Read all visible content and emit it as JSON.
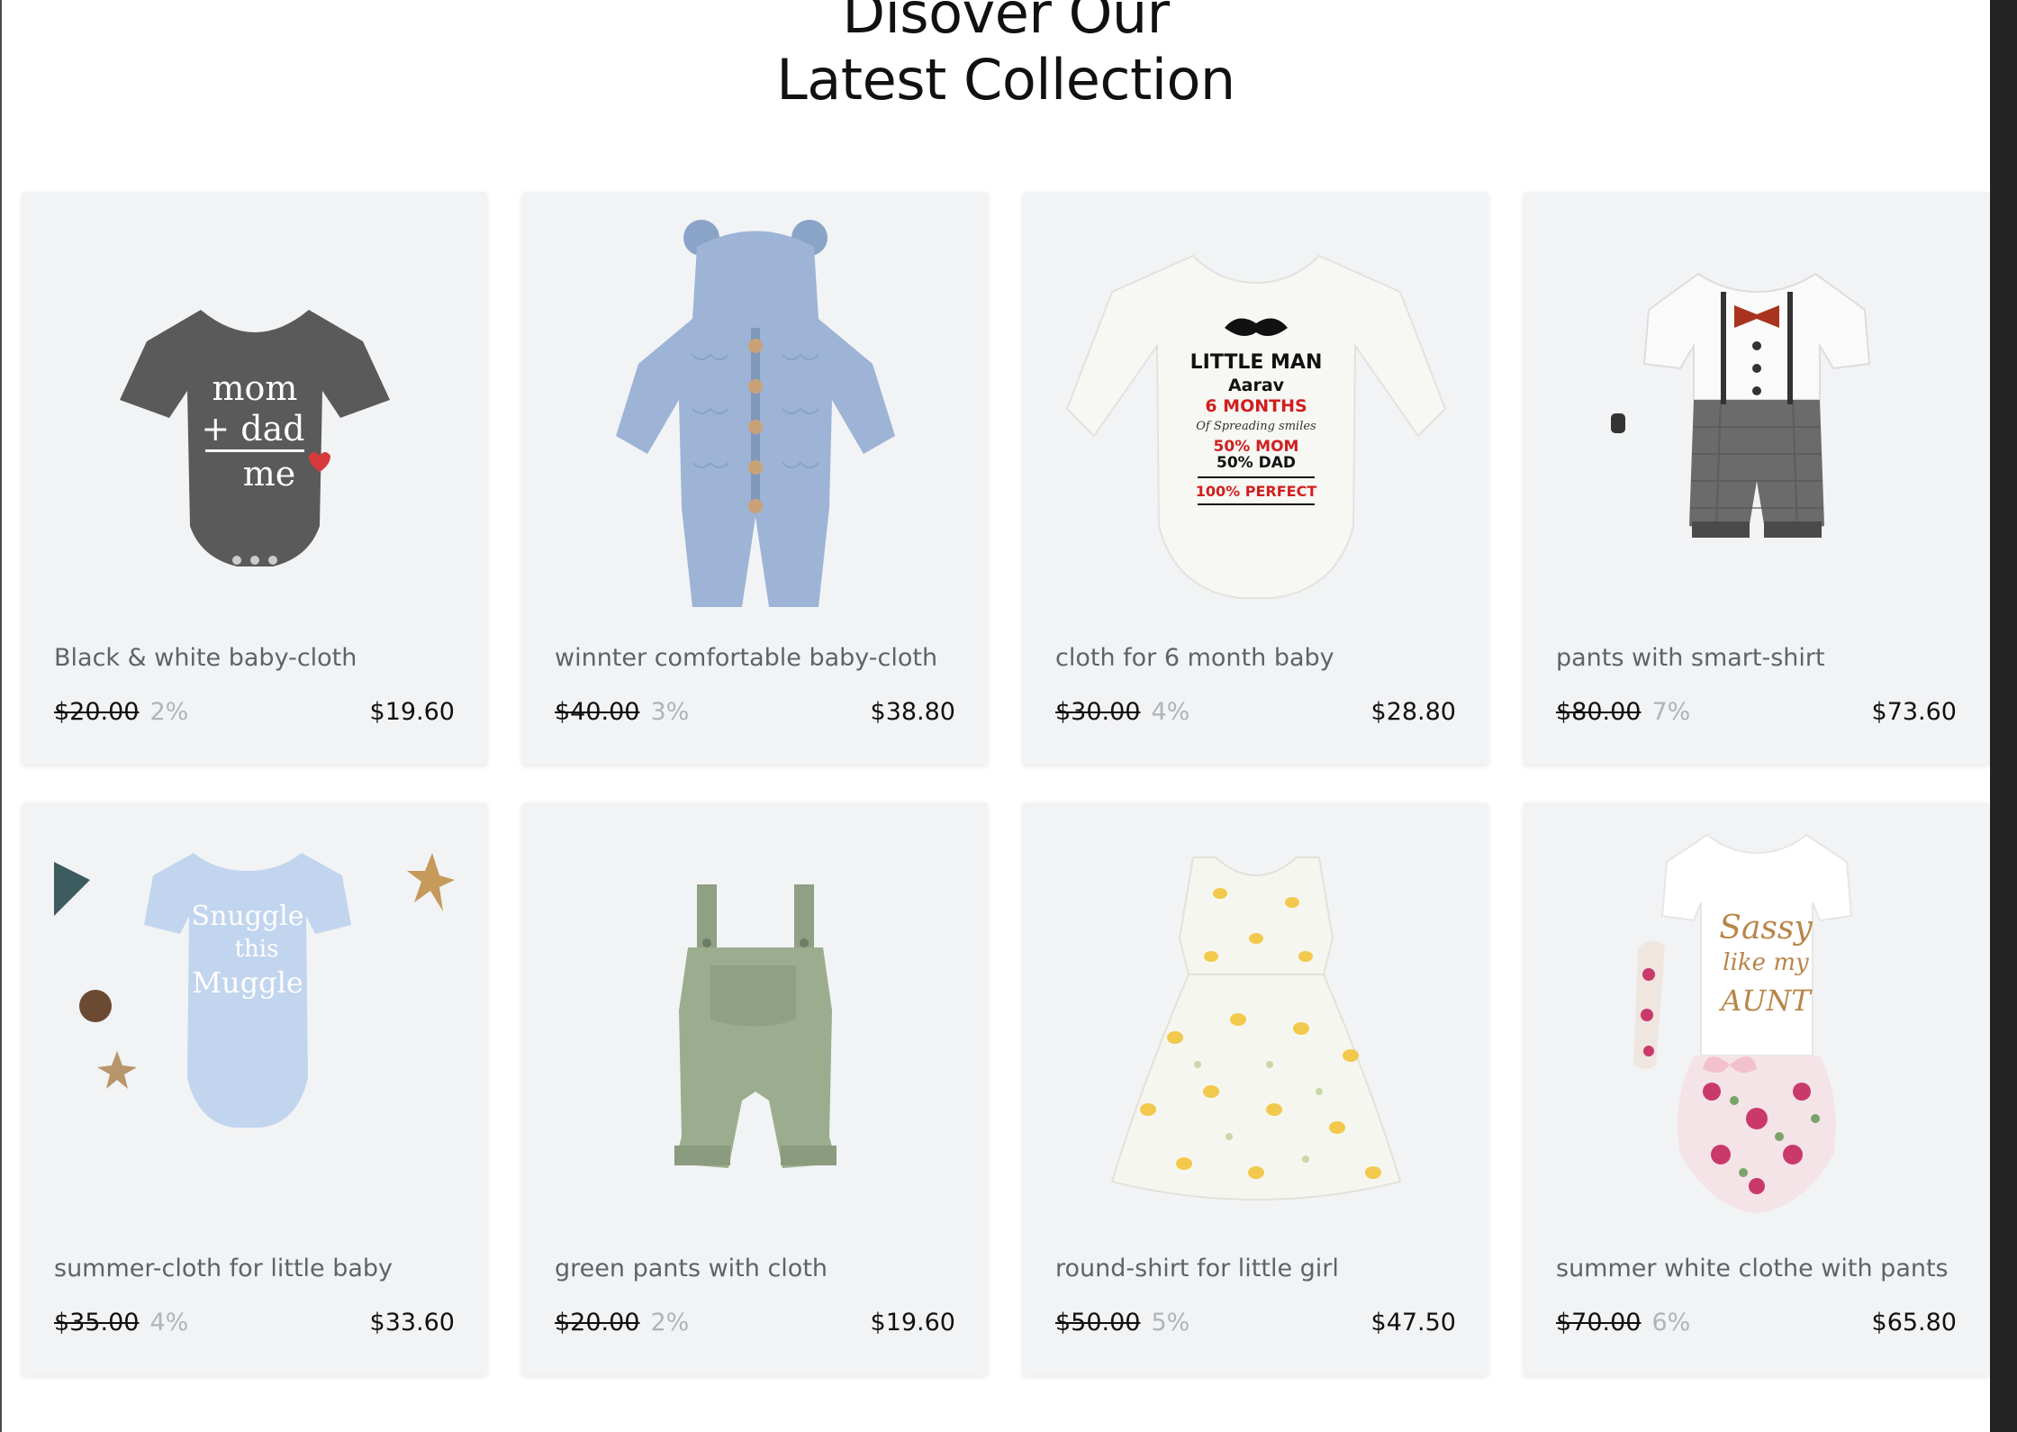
{
  "header": {
    "title_line1": "Disover Our",
    "title_line2": "Latest Collection"
  },
  "products": [
    {
      "name": "Black & white baby-cloth",
      "old_price": "$20.00",
      "discount": "2%",
      "price": "$19.60",
      "image": "grey-onesie-mom-dad-me"
    },
    {
      "name": "winnter comfortable baby-cloth",
      "old_price": "$40.00",
      "discount": "3%",
      "price": "$38.80",
      "image": "blue-knit-hooded-romper"
    },
    {
      "name": "cloth for 6 month baby",
      "old_price": "$30.00",
      "discount": "4%",
      "price": "$28.80",
      "image": "white-long-sleeve-onesie"
    },
    {
      "name": "pants with smart-shirt",
      "old_price": "$80.00",
      "discount": "7%",
      "price": "$73.60",
      "image": "bowtie-suspender-romper"
    },
    {
      "name": "summer-cloth for little baby",
      "old_price": "$35.00",
      "discount": "4%",
      "price": "$33.60",
      "image": "light-blue-onesie"
    },
    {
      "name": "green pants with cloth",
      "old_price": "$20.00",
      "discount": "2%",
      "price": "$19.60",
      "image": "green-overalls"
    },
    {
      "name": "round-shirt for little girl",
      "old_price": "$50.00",
      "discount": "5%",
      "price": "$47.50",
      "image": "lemon-print-dress"
    },
    {
      "name": "summer white clothe with pants",
      "old_price": "$70.00",
      "discount": "6%",
      "price": "$65.80",
      "image": "sassy-onesie-floral-bloomers"
    }
  ],
  "image_text": {
    "p1": [
      "mom",
      "+ dad",
      "me"
    ],
    "p3": [
      "LITTLE MAN",
      "Aarav",
      "6 MONTHS",
      "Of Spreading smiles",
      "50% MOM",
      "50% DAD",
      "100% PERFECT"
    ],
    "p5": [
      "Snuggle",
      "this",
      "Muggle"
    ],
    "p8": [
      "Sassy",
      "like my",
      "AUNT"
    ]
  },
  "colors": {
    "card_bg": "#f2f3f5",
    "product_name": "#5f6368",
    "discount": "#b0b3b8",
    "price": "#111111"
  }
}
